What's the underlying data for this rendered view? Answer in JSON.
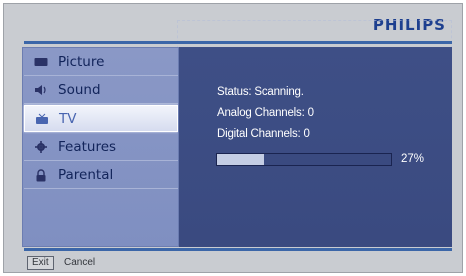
{
  "brand": "PHILIPS",
  "menu": {
    "items": [
      {
        "label": "Picture",
        "icon": "picture-icon"
      },
      {
        "label": "Sound",
        "icon": "speaker-icon"
      },
      {
        "label": "TV",
        "icon": "tv-icon",
        "selected": true
      },
      {
        "label": "Features",
        "icon": "gear-icon"
      },
      {
        "label": "Parental",
        "icon": "lock-icon"
      }
    ]
  },
  "scan": {
    "status": "Status: Scanning.",
    "analog": "Analog Channels: 0",
    "digital": "Digital Channels: 0",
    "progress_fraction": 0.27,
    "progress_label": "27%"
  },
  "footer": {
    "exit_label": "Exit",
    "cancel_label": "Cancel"
  },
  "colors": {
    "accent": "#1d3f8f",
    "content_bg": "#3e4f86",
    "menu_bg": "#8a98c6"
  }
}
